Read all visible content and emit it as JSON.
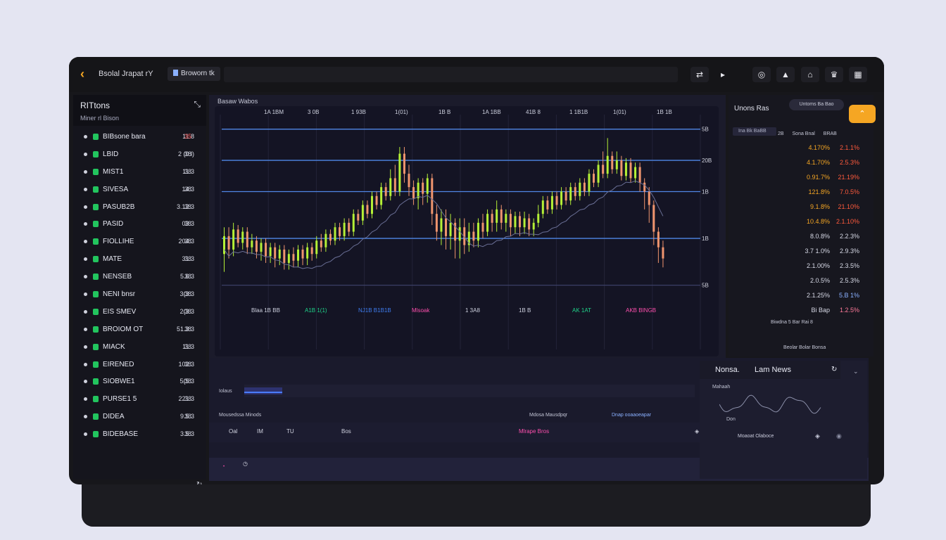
{
  "window": {
    "title": "Bsolal Jrapat rY",
    "workspace_tab": "Broworn tk"
  },
  "toolbar_icons": [
    "swap-icon",
    "cursor-icon",
    "target-icon",
    "tag-icon",
    "alert-icon",
    "crown-icon",
    "layout-icon"
  ],
  "watchlist": {
    "title": "RITtons",
    "subtitle": "Miner   rl Bison",
    "items": [
      {
        "symbol": "BIBsone bara",
        "price": "11.8",
        "change": "35"
      },
      {
        "symbol": "LBID",
        "price": "2 (0.l)",
        "change": "38"
      },
      {
        "symbol": "MIST1",
        "price": "11.3",
        "change": "38"
      },
      {
        "symbol": "SIVESA",
        "price": "14.3",
        "change": "38"
      },
      {
        "symbol": "PASUB2B",
        "price": "3.12.3",
        "change": "38"
      },
      {
        "symbol": "PASID",
        "price": "03.3",
        "change": "38"
      },
      {
        "symbol": "FIOLLIHE",
        "price": "204.3",
        "change": "38"
      },
      {
        "symbol": "MATE",
        "price": "31.3",
        "change": "38"
      },
      {
        "symbol": "NENSEB",
        "price": "5.6.3",
        "change": "38"
      },
      {
        "symbol": "NENI bnsr",
        "price": "3(3.3",
        "change": "38"
      },
      {
        "symbol": "EIS SMEV",
        "price": "2(3.3",
        "change": "38"
      },
      {
        "symbol": "BROIOM OT",
        "price": "51.3.3",
        "change": "38"
      },
      {
        "symbol": "MIACK",
        "price": "11.3",
        "change": "38"
      },
      {
        "symbol": "EIRENED",
        "price": "102.3",
        "change": "38"
      },
      {
        "symbol": "SIOBWE1",
        "price": "5(5.3",
        "change": "38"
      },
      {
        "symbol": "PURSE1 5",
        "price": "221.3",
        "change": "38"
      },
      {
        "symbol": "DIDEA",
        "price": "9.5.3",
        "change": "38"
      },
      {
        "symbol": "BIDEBASE",
        "price": "3.5.3",
        "change": "38"
      }
    ]
  },
  "chart": {
    "title": "Basaw  Wabos",
    "top_labels": [
      "1A 1BM",
      "3 0B",
      "1 93B",
      "1(01)",
      "1B B",
      "1A 1BB",
      "41B 8",
      "1 1B1B",
      "1(01)",
      "1B 1B"
    ],
    "right_axis": [
      "5B",
      "20B",
      "1B",
      "1B",
      "5B"
    ],
    "bottom_labels": [
      "Blaa 1B BB",
      "A1B 1(1)",
      "NJ1B B1B1B",
      "Mlsoak",
      "1 3A8",
      "1B B",
      "AK 1AT",
      "AKB BINGB"
    ],
    "colors": {
      "up": "#b4f036",
      "down": "#f0956e",
      "level": "#4f86e6",
      "pink": "#ff4fae",
      "green": "#1fd38a",
      "blue": "#3f7df0"
    }
  },
  "chart_data": {
    "type": "candlestick",
    "candles": [
      [
        52,
        60,
        44,
        64
      ],
      [
        60,
        54,
        50,
        64
      ],
      [
        54,
        63,
        51,
        66
      ],
      [
        63,
        57,
        55,
        65
      ],
      [
        57,
        62,
        54,
        64
      ],
      [
        62,
        55,
        52,
        64
      ],
      [
        55,
        58,
        52,
        61
      ],
      [
        58,
        53,
        50,
        60
      ],
      [
        53,
        57,
        49,
        59
      ],
      [
        57,
        51,
        48,
        59
      ],
      [
        51,
        55,
        48,
        57
      ],
      [
        55,
        50,
        46,
        57
      ],
      [
        50,
        54,
        47,
        56
      ],
      [
        54,
        48,
        45,
        56
      ],
      [
        48,
        52,
        45,
        54
      ],
      [
        52,
        49,
        46,
        55
      ],
      [
        49,
        54,
        46,
        56
      ],
      [
        54,
        50,
        47,
        56
      ],
      [
        50,
        55,
        47,
        57
      ],
      [
        55,
        52,
        49,
        57
      ],
      [
        52,
        58,
        50,
        60
      ],
      [
        58,
        55,
        53,
        61
      ],
      [
        55,
        61,
        53,
        63
      ],
      [
        61,
        58,
        56,
        63
      ],
      [
        58,
        64,
        56,
        66
      ],
      [
        64,
        60,
        58,
        66
      ],
      [
        60,
        66,
        58,
        68
      ],
      [
        66,
        62,
        60,
        68
      ],
      [
        62,
        70,
        60,
        72
      ],
      [
        70,
        67,
        65,
        72
      ],
      [
        67,
        74,
        65,
        76
      ],
      [
        74,
        70,
        68,
        76
      ],
      [
        70,
        78,
        68,
        80
      ],
      [
        78,
        74,
        72,
        80
      ],
      [
        74,
        82,
        72,
        84
      ],
      [
        82,
        78,
        76,
        84
      ],
      [
        78,
        86,
        76,
        90
      ],
      [
        86,
        80,
        78,
        92
      ],
      [
        80,
        97,
        78,
        100
      ],
      [
        97,
        88,
        84,
        100
      ],
      [
        88,
        82,
        78,
        92
      ],
      [
        82,
        77,
        74,
        85
      ],
      [
        77,
        84,
        72,
        86
      ],
      [
        84,
        79,
        74,
        86
      ],
      [
        79,
        86,
        75,
        88
      ],
      [
        86,
        70,
        65,
        88
      ],
      [
        70,
        62,
        58,
        74
      ],
      [
        62,
        68,
        56,
        72
      ],
      [
        68,
        60,
        54,
        72
      ],
      [
        60,
        66,
        54,
        70
      ],
      [
        66,
        58,
        50,
        68
      ],
      [
        58,
        64,
        50,
        68
      ],
      [
        64,
        56,
        52,
        68
      ],
      [
        56,
        62,
        53,
        66
      ],
      [
        62,
        58,
        55,
        66
      ],
      [
        58,
        66,
        55,
        68
      ],
      [
        66,
        62,
        59,
        70
      ],
      [
        62,
        70,
        60,
        72
      ],
      [
        70,
        66,
        62,
        72
      ],
      [
        66,
        72,
        62,
        76
      ],
      [
        72,
        66,
        63,
        74
      ],
      [
        66,
        70,
        62,
        72
      ],
      [
        70,
        64,
        60,
        72
      ],
      [
        64,
        69,
        61,
        71
      ],
      [
        69,
        64,
        60,
        71
      ],
      [
        64,
        68,
        61,
        71
      ],
      [
        68,
        63,
        60,
        70
      ],
      [
        63,
        66,
        60,
        68
      ],
      [
        66,
        70,
        64,
        74
      ],
      [
        70,
        76,
        68,
        78
      ],
      [
        76,
        72,
        70,
        78
      ],
      [
        72,
        78,
        70,
        80
      ],
      [
        78,
        74,
        72,
        80
      ],
      [
        74,
        80,
        72,
        82
      ],
      [
        80,
        76,
        74,
        82
      ],
      [
        76,
        82,
        74,
        84
      ],
      [
        82,
        78,
        76,
        84
      ],
      [
        78,
        84,
        76,
        86
      ],
      [
        84,
        80,
        78,
        86
      ],
      [
        80,
        88,
        78,
        90
      ],
      [
        88,
        84,
        82,
        90
      ],
      [
        84,
        92,
        82,
        94
      ],
      [
        92,
        88,
        86,
        98
      ],
      [
        88,
        96,
        86,
        104
      ],
      [
        96,
        90,
        88,
        98
      ],
      [
        90,
        94,
        88,
        98
      ],
      [
        94,
        87,
        85,
        96
      ],
      [
        87,
        93,
        85,
        95
      ],
      [
        93,
        86,
        84,
        95
      ],
      [
        86,
        91,
        84,
        93
      ],
      [
        91,
        84,
        80,
        93
      ],
      [
        84,
        80,
        72,
        86
      ],
      [
        80,
        74,
        66,
        82
      ],
      [
        74,
        62,
        56,
        76
      ],
      [
        62,
        55,
        48,
        64
      ],
      [
        55,
        50,
        46,
        58
      ]
    ],
    "levels": [
      108,
      94,
      80,
      59,
      38
    ],
    "ylim": [
      30,
      112
    ]
  },
  "orderbook": {
    "title": "Unons Ras",
    "selector": "Untoms Ba Bao",
    "filter": "Ina Bk BaBB",
    "head": [
      "2B",
      "Sona Bnal",
      "BRAB"
    ],
    "rows": [
      {
        "a": "4.170%",
        "b": "2.1.1%",
        "ac": "#f5a623",
        "bc": "#ff5a3c"
      },
      {
        "a": "4.1.70%",
        "b": "2.5.3%",
        "ac": "#f5a623",
        "bc": "#ff5a3c"
      },
      {
        "a": "0.91.7%",
        "b": "21.19%",
        "ac": "#f5a623",
        "bc": "#ff5a3c"
      },
      {
        "a": "121.8%",
        "b": "7.0.5%",
        "ac": "#f5a623",
        "bc": "#ff5a3c"
      },
      {
        "a": "9.1.8%",
        "b": "21.10%",
        "ac": "#f5a623",
        "bc": "#ff5a3c"
      },
      {
        "a": "10.4.8%",
        "b": "2.1.10%",
        "ac": "#f5a623",
        "bc": "#ff5a3c"
      },
      {
        "a": "8.0.8%",
        "b": "2.2.3%",
        "ac": "#d7d9e6",
        "bc": "#d7d9e6"
      },
      {
        "a": "3.7 1.0%",
        "b": "2.9.3%",
        "ac": "#d7d9e6",
        "bc": "#d7d9e6"
      },
      {
        "a": "2.1.00%",
        "b": "2.3.5%",
        "ac": "#d7d9e6",
        "bc": "#d7d9e6"
      },
      {
        "a": "2.0.5%",
        "b": "2.5.3%",
        "ac": "#d7d9e6",
        "bc": "#d7d9e6"
      },
      {
        "a": "2.1.25%",
        "b": "5.B 1%",
        "ac": "#d7d9e6",
        "bc": "#8ab0ff"
      },
      {
        "a": "Bi Bap",
        "b": "1.2.5%",
        "ac": "#d7d9e6",
        "bc": "#ff7a9a"
      }
    ],
    "foot1": "Biwdna 5 Bar   Rai 8",
    "foot2": "Beolar  Bolar  Bonsa"
  },
  "bottom": {
    "label1": "Iolaus",
    "label2": "Mousedssa Minods",
    "label3": "Mdosa Mausdpqr",
    "label4": "Dnap ooaaoeapar",
    "columns": [
      "Oal",
      "IM",
      "TU",
      "Bos",
      "Mlrape Bros"
    ],
    "news_tabs": [
      "Nonsa.",
      "Lam News"
    ],
    "news_spark_label": "Mahaah",
    "news_spark_label2": "Don",
    "news_footer": "Moaoat Olaboce"
  }
}
